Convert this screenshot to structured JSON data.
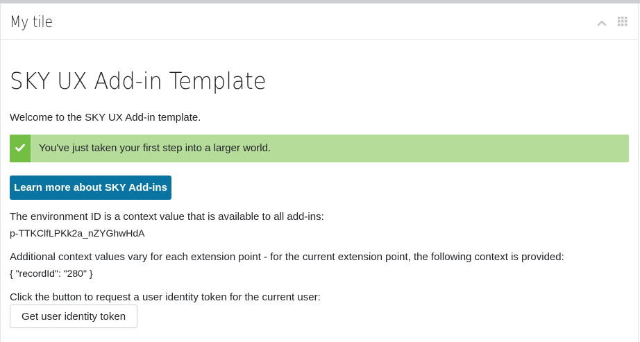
{
  "tile": {
    "title": "My tile",
    "collapse_icon": "chevron-up-icon",
    "drag_icon": "grip-icon"
  },
  "main": {
    "heading": "SKY UX Add-in Template",
    "welcome": "Welcome to the SKY UX Add-in template.",
    "alert": {
      "icon": "check-icon",
      "text": "You've just taken your first step into a larger world.",
      "color": "#b6dc9a",
      "icon_color": "#72bf44"
    },
    "learn_more_label": "Learn more about SKY Add-ins",
    "env_label": "The environment ID is a context value that is available to all add-ins:",
    "env_value": "p-TTKClfLPKk2a_nZYGhwHdA",
    "context_label": "Additional context values vary for each extension point - for the current extension point, the following context is provided:",
    "context_value": "{ \"recordId\": \"280\" }",
    "token_label": "Click the button to request a user identity token for the current user:",
    "token_button_label": "Get user identity token"
  },
  "colors": {
    "primary": "#0974a1",
    "success_bg": "#b6dc9a",
    "success_icon_bg": "#72bf44"
  }
}
